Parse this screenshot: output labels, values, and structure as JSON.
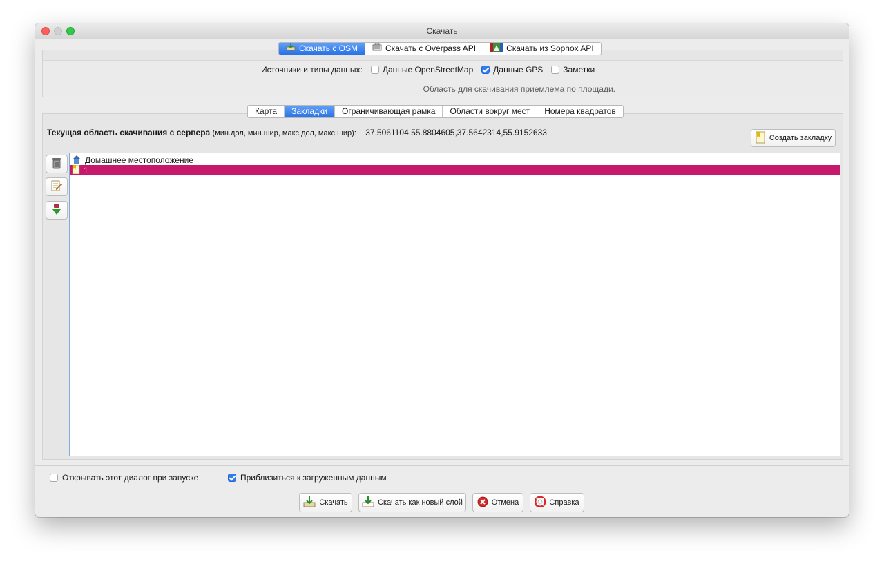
{
  "window": {
    "title": "Скачать"
  },
  "server_tabs": [
    {
      "label": "Скачать с OSM",
      "icon": "osm-download-icon",
      "active": true
    },
    {
      "label": "Скачать с Overpass API",
      "icon": "overpass-icon",
      "active": false
    },
    {
      "label": "Скачать из Sophox API",
      "icon": "sophox-icon",
      "active": false
    }
  ],
  "sources": {
    "label": "Источники и типы данных:",
    "options": [
      {
        "label": "Данные OpenStreetMap",
        "checked": false
      },
      {
        "label": "Данные GPS",
        "checked": true
      },
      {
        "label": "Заметки",
        "checked": false
      }
    ],
    "area_status": "Область для скачивания приемлема по площади."
  },
  "area_tabs": [
    {
      "label": "Карта",
      "active": false
    },
    {
      "label": "Закладки",
      "active": true
    },
    {
      "label": "Ограничивающая рамка",
      "active": false
    },
    {
      "label": "Области вокруг мест",
      "active": false
    },
    {
      "label": "Номера квадратов",
      "active": false
    }
  ],
  "current_area": {
    "label": "Текущая область скачивания с сервера",
    "format": "(мин.дол, мин.шир, макс.дол, макс.шир):",
    "value": "37.5061104,55.8804605,37.5642314,55.9152633"
  },
  "create_bookmark_label": "Создать закладку",
  "bookmarks": [
    {
      "label": "Домашнее местоположение",
      "icon": "home-icon",
      "selected": false
    },
    {
      "label": "1",
      "icon": "bookmark-icon",
      "selected": true
    }
  ],
  "selection_color": "#c7196c",
  "accent_color": "#2f7cf6",
  "options": {
    "open_on_start": {
      "label": "Открывать этот диалог при запуске",
      "checked": false
    },
    "zoom_to_data": {
      "label": "Приблизиться к загруженным данным",
      "checked": true
    }
  },
  "buttons": {
    "download": "Скачать",
    "download_new_layer": "Скачать как новый слой",
    "cancel": "Отмена",
    "help": "Справка"
  }
}
